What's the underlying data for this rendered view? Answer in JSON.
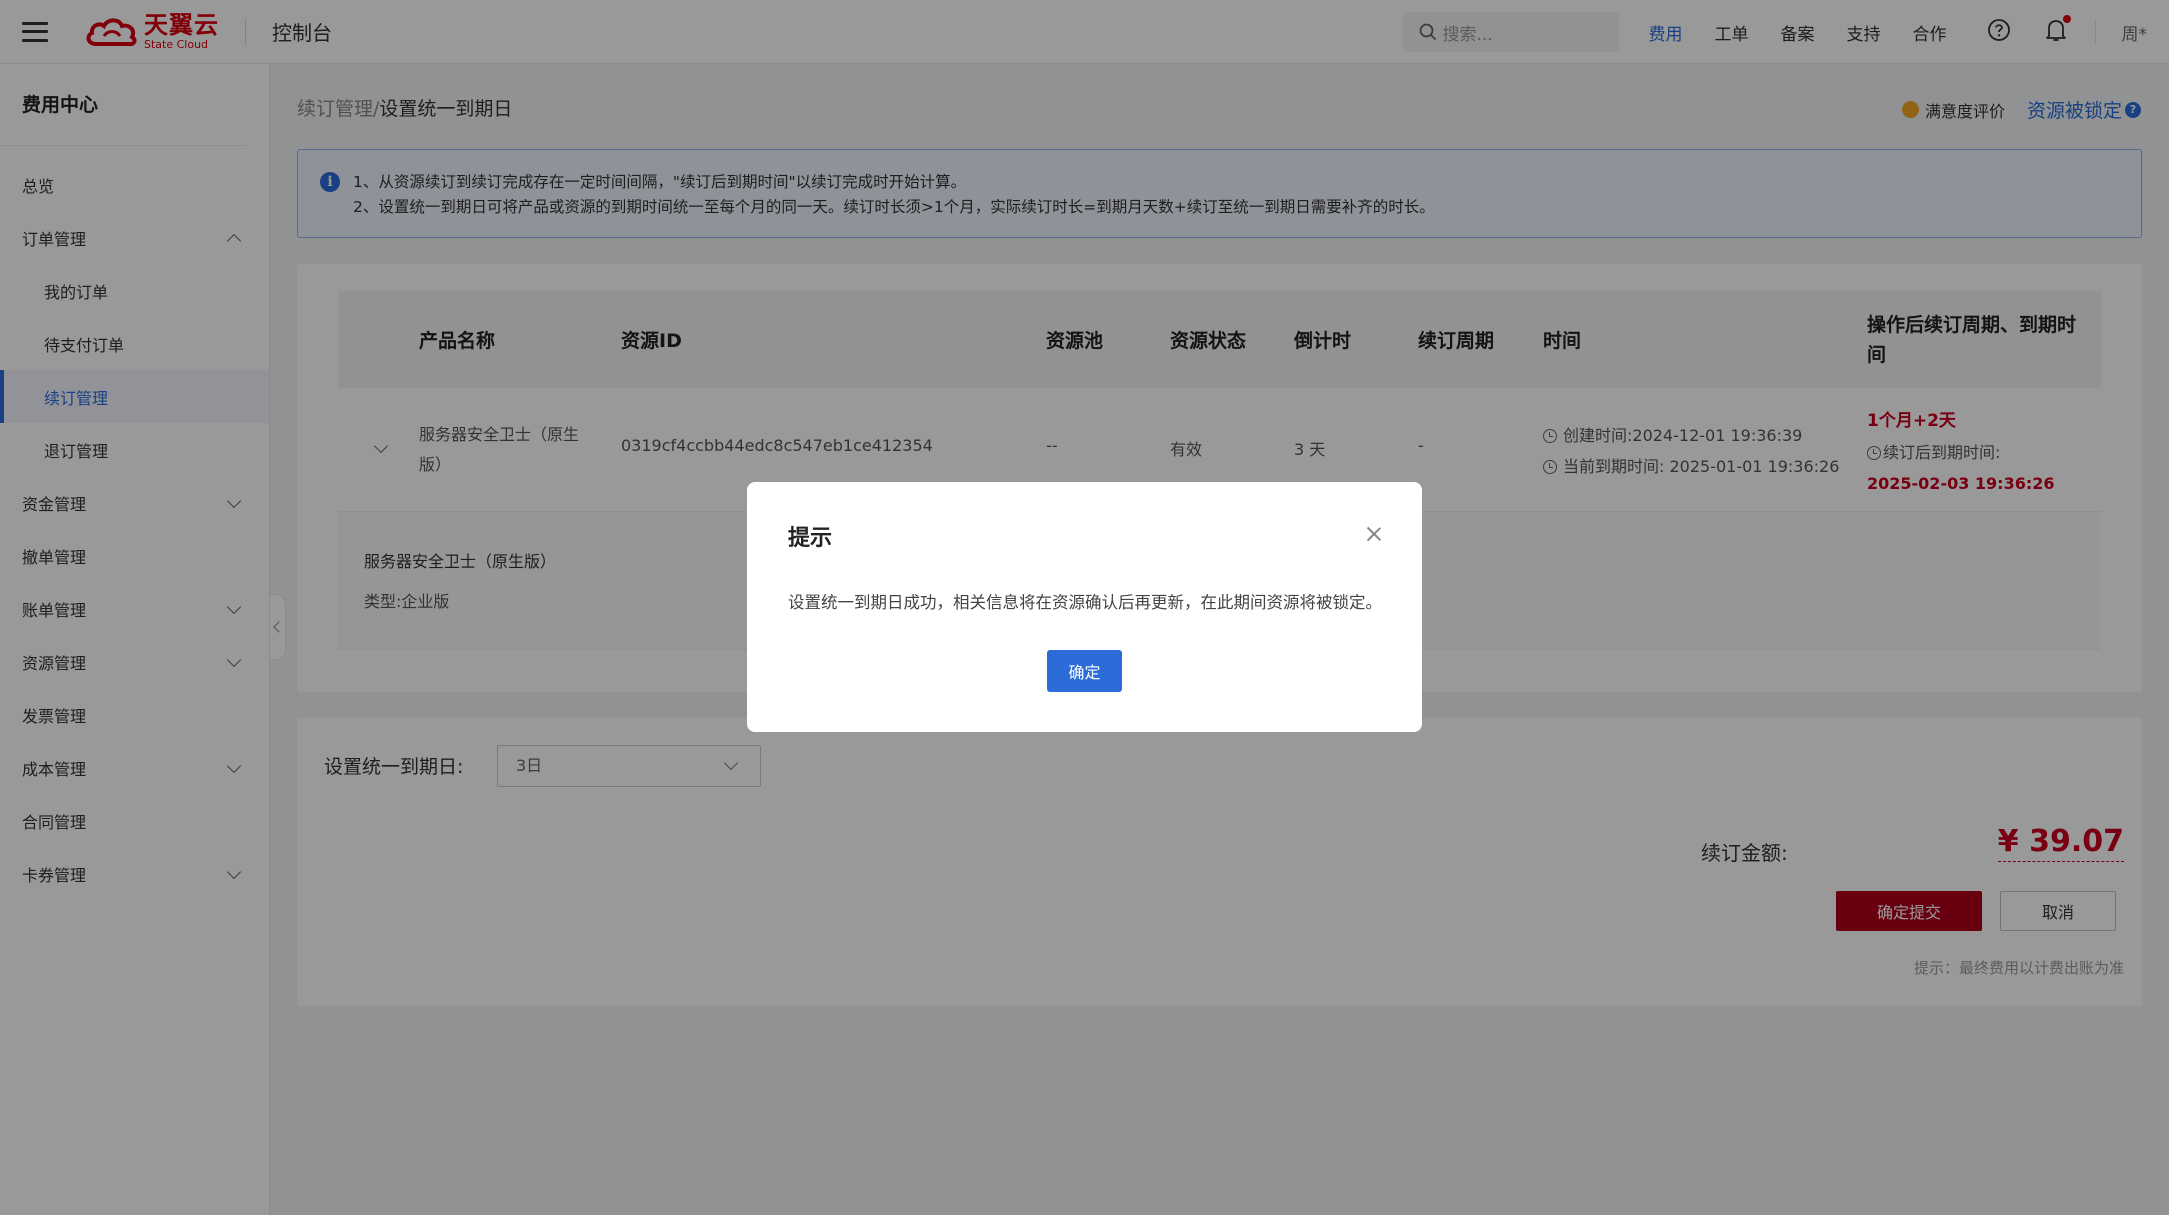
{
  "topbar": {
    "logo_cn": "天翼云",
    "logo_en": "State Cloud",
    "console": "控制台",
    "search_placeholder": "搜索...",
    "links": [
      "费用",
      "工单",
      "备案",
      "支持",
      "合作"
    ],
    "user": "周*"
  },
  "sidebar": {
    "title": "费用中心",
    "items": [
      {
        "label": "总览"
      },
      {
        "label": "订单管理"
      },
      {
        "label": "我的订单"
      },
      {
        "label": "待支付订单"
      },
      {
        "label": "续订管理"
      },
      {
        "label": "退订管理"
      },
      {
        "label": "资金管理"
      },
      {
        "label": "撤单管理"
      },
      {
        "label": "账单管理"
      },
      {
        "label": "资源管理"
      },
      {
        "label": "发票管理"
      },
      {
        "label": "成本管理"
      },
      {
        "label": "合同管理"
      },
      {
        "label": "卡券管理"
      }
    ]
  },
  "breadcrumb": {
    "parent": "续订管理",
    "sep": "/",
    "current": "设置统一到期日"
  },
  "header_right": {
    "rating": "满意度评价",
    "locked": "资源被锁定"
  },
  "notice": {
    "line1": "1、从资源续订到续订完成存在一定时间间隔，\"续订后到期时间\"以续订完成时开始计算。",
    "line2": "2、设置统一到期日可将产品或资源的到期时间统一至每个月的同一天。续订时长须>1个月，实际续订时长=到期月天数+续订至统一到期日需要补齐的时长。"
  },
  "table": {
    "headers": {
      "product": "产品名称",
      "resource_id": "资源ID",
      "pool": "资源池",
      "status": "资源状态",
      "countdown": "倒计时",
      "period": "续订周期",
      "time": "时间",
      "after_line1": "操作后续订周期、到期时",
      "after_line2": "间"
    },
    "row": {
      "product_line1": "服务器安全卫士（原生",
      "product_line2": "版）",
      "resource_id": "0319cf4ccbb44edc8c547eb1ce412354",
      "pool": "--",
      "status": "有效",
      "countdown": "3 天",
      "period": "-",
      "created": "创建时间:2024-12-01 19:36:39",
      "expire": "当前到期时间: 2025-01-01 19:36:26",
      "after_period": "1个月+2天",
      "after_label": "续订后到期时间:",
      "after_time": "2025-02-03 19:36:26"
    },
    "detail": {
      "name": "服务器安全卫士（原生版）",
      "type": "类型:企业版"
    }
  },
  "form": {
    "label": "设置统一到期日:",
    "selected": "3日",
    "amount_label": "续订金额:",
    "amount": "¥ 39.07",
    "submit": "确定提交",
    "cancel": "取消",
    "tip": "提示：最终费用以计费出账为准"
  },
  "modal": {
    "title": "提示",
    "message": "设置统一到期日成功，相关信息将在资源确认后再更新，在此期间资源将被锁定。",
    "ok": "确定"
  }
}
